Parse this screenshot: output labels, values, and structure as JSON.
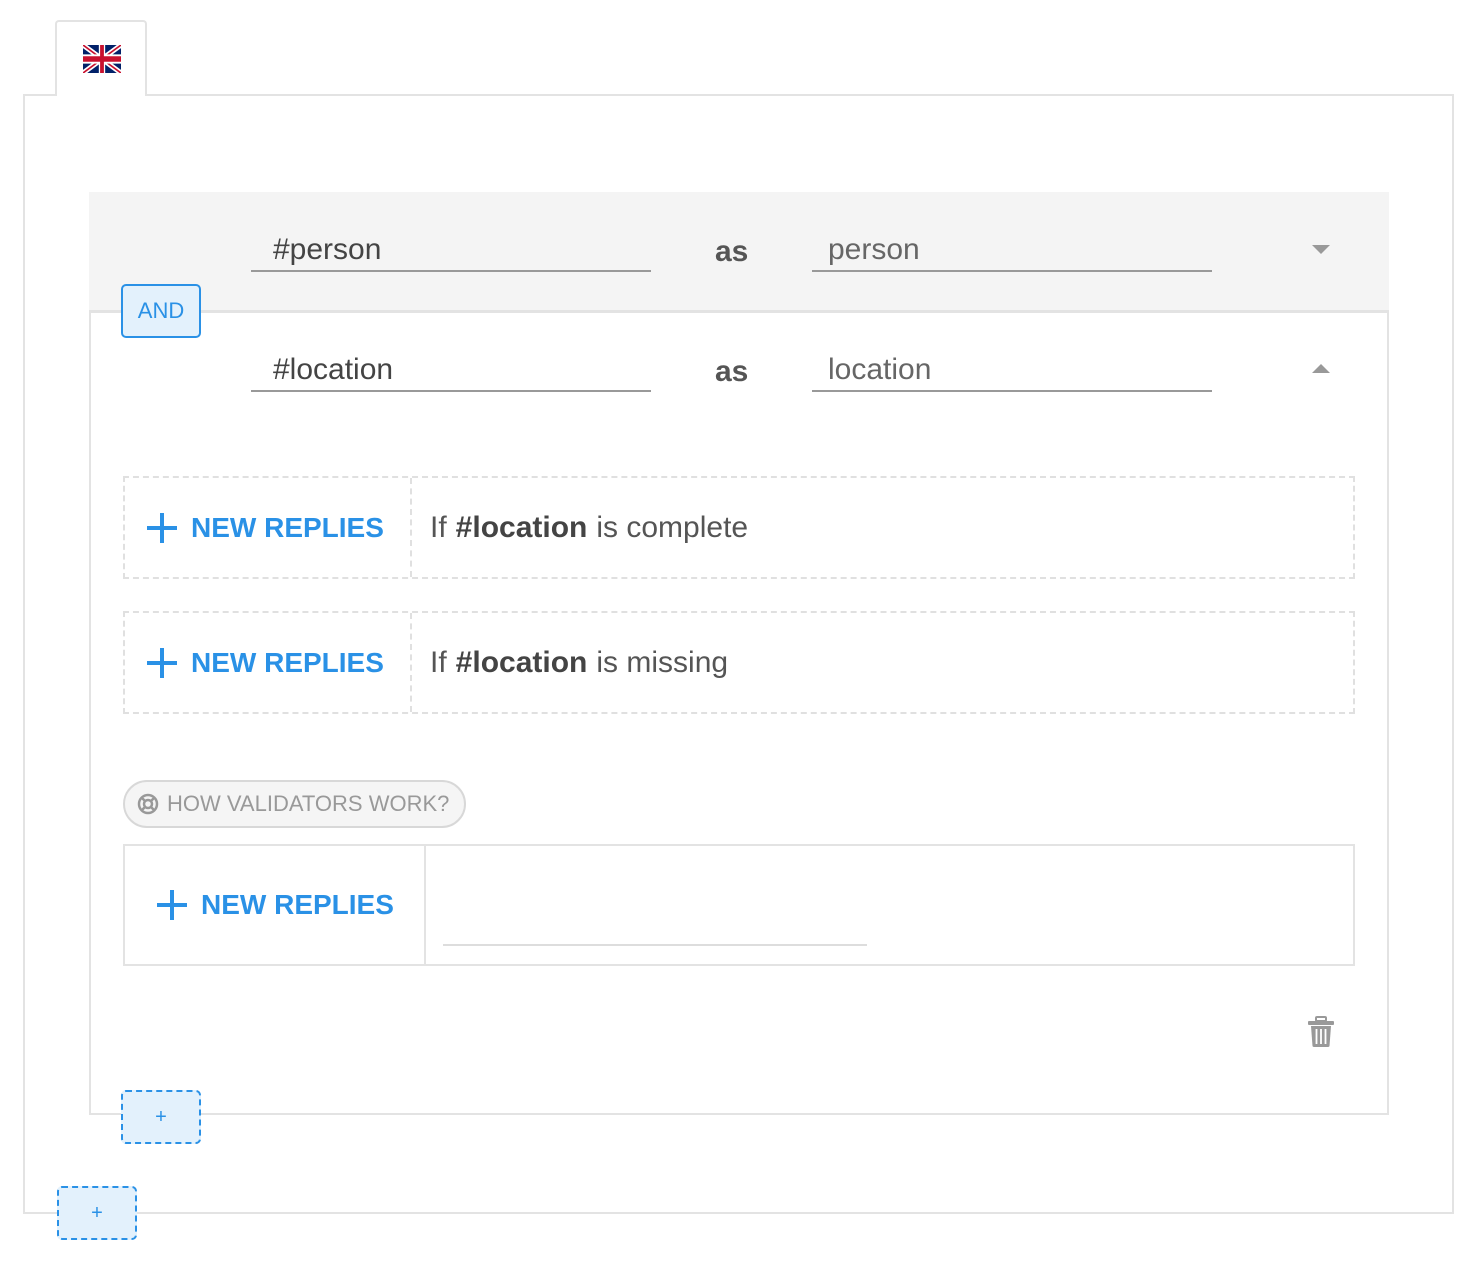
{
  "language_tab": {
    "flag": "uk-flag-icon"
  },
  "entities": [
    {
      "hashtag": "#person",
      "as_label": "as",
      "alias": "person",
      "expanded": false
    },
    {
      "hashtag": "#location",
      "as_label": "as",
      "alias": "location",
      "expanded": true
    }
  ],
  "and_button": "AND",
  "replies": [
    {
      "button": "NEW REPLIES",
      "prefix": "If",
      "entity": "#location",
      "suffix": "is complete"
    },
    {
      "button": "NEW REPLIES",
      "prefix": "If",
      "entity": "#location",
      "suffix": "is missing"
    }
  ],
  "validators_help": "HOW VALIDATORS WORK?",
  "validator_reply": {
    "button": "NEW REPLIES",
    "input_value": ""
  },
  "add_inner": "+",
  "add_outer": "+",
  "colors": {
    "accent": "#2a91e6",
    "accent_bg": "#e3f1fc",
    "border": "#e3e3e3",
    "row_bg": "#f4f4f4"
  }
}
